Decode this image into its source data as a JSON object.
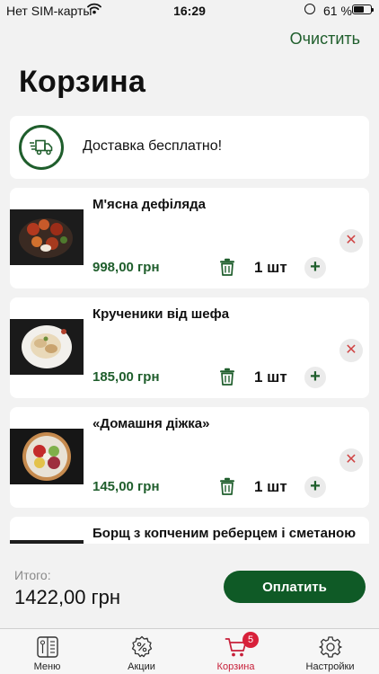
{
  "status_bar": {
    "carrier": "Нет SIM-карты",
    "time": "16:29",
    "battery_pct": "61 %",
    "battery_level": 0.61
  },
  "header": {
    "clear_label": "Очистить",
    "title": "Корзина"
  },
  "delivery": {
    "text": "Доставка бесплатно!"
  },
  "cart_items": [
    {
      "name": "М'ясна дефіляда",
      "price": "998,00 грн",
      "qty": "1 шт"
    },
    {
      "name": "Крученики від шефа",
      "price": "185,00 грн",
      "qty": "1 шт"
    },
    {
      "name": "«Домашня діжка»",
      "price": "145,00 грн",
      "qty": "1 шт"
    },
    {
      "name": "Борщ з копченим реберцем і сметаною"
    }
  ],
  "summary": {
    "total_label": "Итого:",
    "total_value": "1422,00 грн",
    "pay_label": "Оплатить"
  },
  "tabs": [
    {
      "label": "Меню",
      "icon": "menu-book-icon"
    },
    {
      "label": "Акции",
      "icon": "discount-gear-icon"
    },
    {
      "label": "Корзина",
      "icon": "cart-icon",
      "badge": "5",
      "active": true
    },
    {
      "label": "Настройки",
      "icon": "gear-icon"
    }
  ],
  "colors": {
    "accent": "#1f5e2c",
    "pay_button": "#0f5a26",
    "active_tab": "#c7203a",
    "badge": "#d8203a",
    "remove": "#d04545"
  }
}
